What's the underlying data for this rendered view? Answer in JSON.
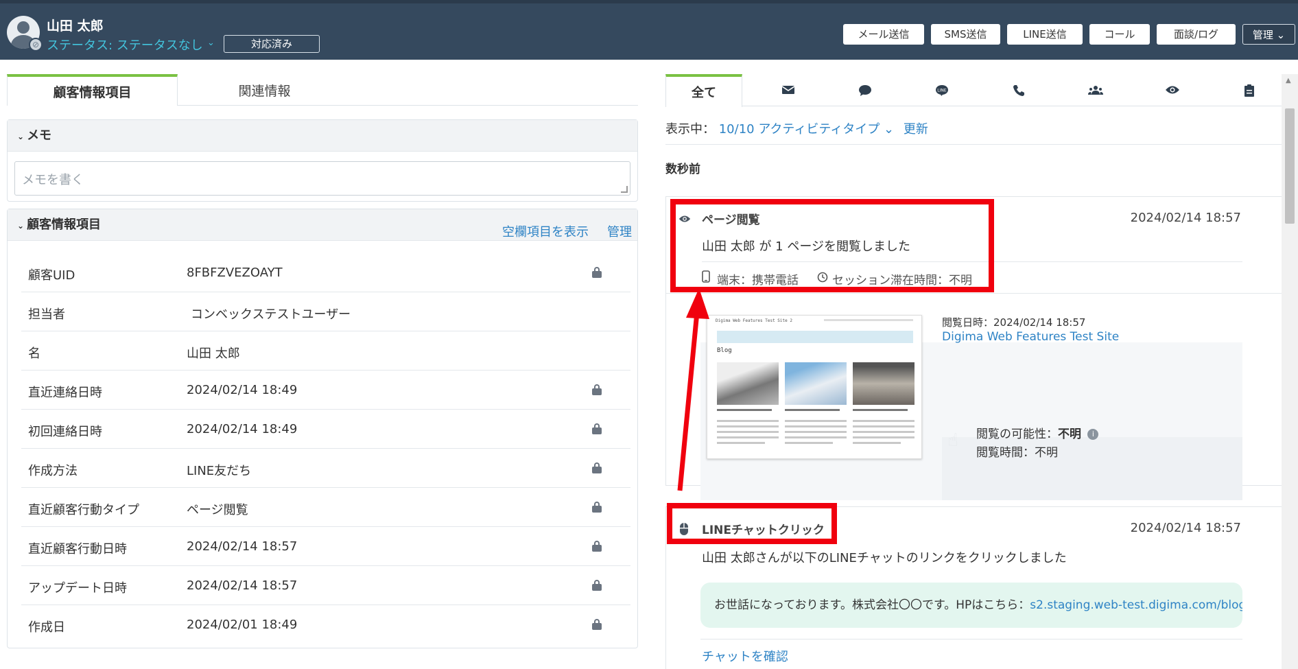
{
  "header": {
    "user_name": "山田 太郎",
    "status": "ステータス: ステータスなし",
    "handled_label": "対応済み",
    "buttons": [
      "メール送信",
      "SMS送信",
      "LINE送信",
      "コール",
      "面談/ログ",
      "管理"
    ]
  },
  "left": {
    "tabs": [
      "顧客情報項目",
      "関連情報"
    ],
    "memo": {
      "title": "メモ",
      "placeholder": "メモを書く"
    },
    "info": {
      "title": "顧客情報項目",
      "show_empty_link": "空欄項目を表示",
      "manage_link": "管理",
      "rows": [
        {
          "label": "顧客UID",
          "value": "8FBFZVEZOAYT",
          "locked": true
        },
        {
          "label": "担当者",
          "value": "コンベックステストユーザー",
          "locked": false
        },
        {
          "label": "名",
          "value": "山田 太郎",
          "locked": false
        },
        {
          "label": "直近連絡日時",
          "value": "2024/02/14 18:49",
          "locked": true
        },
        {
          "label": "初回連絡日時",
          "value": "2024/02/14 18:49",
          "locked": true
        },
        {
          "label": "作成方法",
          "value": "LINE友だち",
          "locked": true
        },
        {
          "label": "直近顧客行動タイプ",
          "value": "ページ閲覧",
          "locked": true
        },
        {
          "label": "直近顧客行動日時",
          "value": "2024/02/14 18:57",
          "locked": true
        },
        {
          "label": "アップデート日時",
          "value": "2024/02/14 18:57",
          "locked": true
        },
        {
          "label": "作成日",
          "value": "2024/02/01 18:49",
          "locked": true
        }
      ]
    }
  },
  "right": {
    "tabs": {
      "all": "全て",
      "icons": [
        "mail-icon",
        "chat-bubble-icon",
        "line-icon",
        "phone-icon",
        "people-icon",
        "eye-icon",
        "clipboard-icon"
      ]
    },
    "filter": {
      "prefix": "表示中：",
      "types": "10/10 アクティビティタイプ",
      "refresh": "更新"
    },
    "time_ago": "数秒前",
    "page_view": {
      "title": "ページ閲覧",
      "date": "2024/02/14 18:57",
      "text": "山田 太郎 が 1 ページを閲覧しました",
      "device": "端末：携帯電話",
      "session": "セッション滞在時間：不明",
      "viewed_at": "閲覧日時：2024/02/14 18:57",
      "site_link": "Digima Web Features Test Site",
      "possibility_label": "閲覧の可能性：",
      "possibility_value": "不明",
      "view_time": "閲覧時間：不明",
      "thumb_title": "Digima Web Features Test Site 2",
      "thumb_blog": "Blog"
    },
    "line_click": {
      "title": "LINEチャットクリック",
      "date": "2024/02/14 18:57",
      "text": "山田 太郎さんが以下のLINEチャットのリンクをクリックしました",
      "message": "お世話になっております。株式会社〇〇です。HPはこちら：",
      "message_link": "s2.staging.web-test.digima.com/blog",
      "confirm": "チャットを確認"
    }
  },
  "colors": {
    "header_bg": "#35495e",
    "status_cyan": "#43c5de",
    "accent_green": "#7ac143",
    "link_blue": "#2e83c5",
    "annotation_red": "#f0000e"
  }
}
